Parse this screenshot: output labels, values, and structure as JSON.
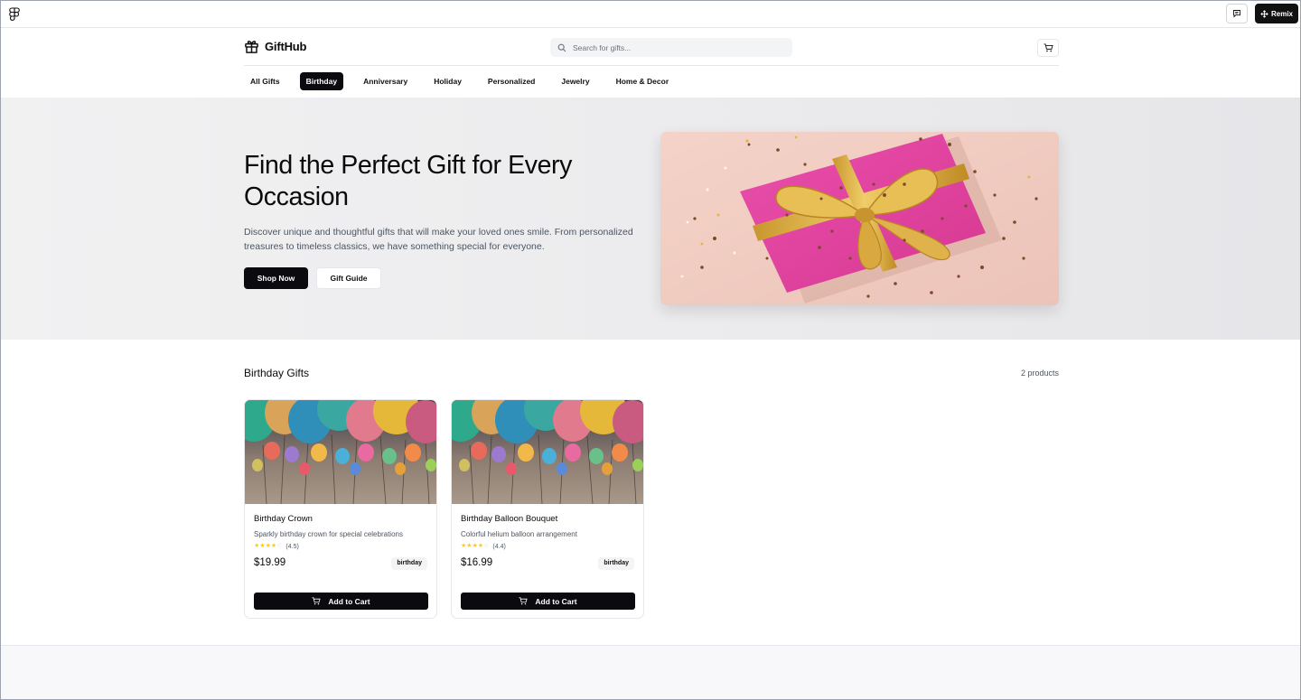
{
  "toolbar": {
    "logo_icon": "figma-icon",
    "comment_icon": "comment-icon",
    "remix_label": "Remix",
    "remix_icon": "remix-icon"
  },
  "header": {
    "brand": "GiftHub",
    "brand_icon": "gift-icon",
    "search_placeholder": "Search for gifts...",
    "search_icon": "search-icon",
    "cart_icon": "cart-icon"
  },
  "categories": [
    {
      "label": "All Gifts",
      "active": false
    },
    {
      "label": "Birthday",
      "active": true
    },
    {
      "label": "Anniversary",
      "active": false
    },
    {
      "label": "Holiday",
      "active": false
    },
    {
      "label": "Personalized",
      "active": false
    },
    {
      "label": "Jewelry",
      "active": false
    },
    {
      "label": "Home & Decor",
      "active": false
    }
  ],
  "hero": {
    "title": "Find the Perfect Gift for Every Occasion",
    "description": "Discover unique and thoughtful gifts that will make your loved ones smile. From personalized treasures to timeless classics, we have something special for everyone.",
    "primary_cta": "Shop Now",
    "secondary_cta": "Gift Guide",
    "image": "pink-gift-box-with-gold-ribbon"
  },
  "products": {
    "section_title": "Birthday Gifts",
    "count_text": "2 products",
    "items": [
      {
        "name": "Birthday Crown",
        "description": "Sparkly birthday crown for special celebrations",
        "rating": 4.5,
        "rating_text": "(4.5)",
        "price": "$19.99",
        "tag": "birthday",
        "cta": "Add to Cart",
        "image": "colorful-balloons"
      },
      {
        "name": "Birthday Balloon Bouquet",
        "description": "Colorful helium balloon arrangement",
        "rating": 4.4,
        "rating_text": "(4.4)",
        "price": "$16.99",
        "tag": "birthday",
        "cta": "Add to Cart",
        "image": "colorful-balloons"
      }
    ]
  },
  "colors": {
    "primary": "#0a0a0f",
    "star": "#facc15",
    "gift_pink": "#e0409c",
    "ribbon_gold": "#d4a93a"
  }
}
